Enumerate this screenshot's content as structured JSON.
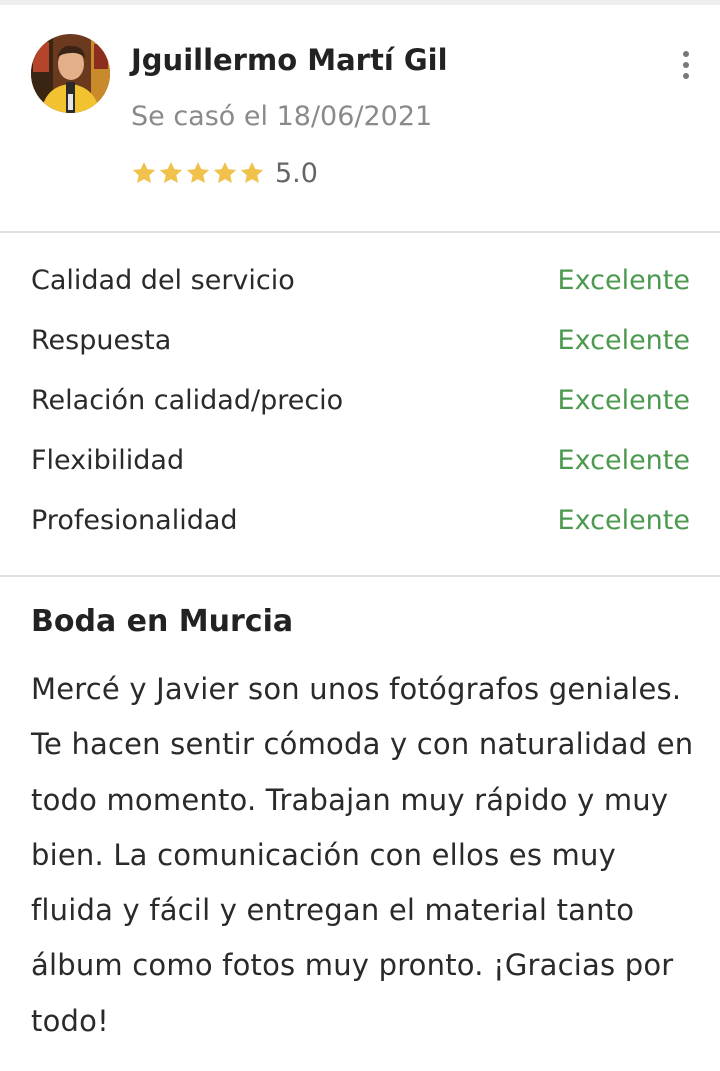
{
  "review": {
    "author": "Jguillermo Martí Gil",
    "wedding_date": "Se casó el 18/06/2021",
    "rating_value": "5.0",
    "rating_stars": 5,
    "star_color": "#f0c24b",
    "avatar_icon": "user-photo-avatar",
    "menu_icon": "more-vertical-icon"
  },
  "ratings": [
    {
      "label": "Calidad del servicio",
      "grade": "Excelente"
    },
    {
      "label": "Respuesta",
      "grade": "Excelente"
    },
    {
      "label": "Relación calidad/precio",
      "grade": "Excelente"
    },
    {
      "label": "Flexibilidad",
      "grade": "Excelente"
    },
    {
      "label": "Profesionalidad",
      "grade": "Excelente"
    }
  ],
  "grade_color": "#4c9a4f",
  "body": {
    "title": "Boda en Murcia",
    "text": "Mercé y Javier son unos fotógrafos geniales. Te hacen sentir cómoda y con naturalidad en todo momento. Trabajan muy rápido y muy bien. La comunicación con ellos es muy fluida y fácil y entregan el material tanto álbum como fotos muy pronto. ¡Gracias por todo!"
  }
}
